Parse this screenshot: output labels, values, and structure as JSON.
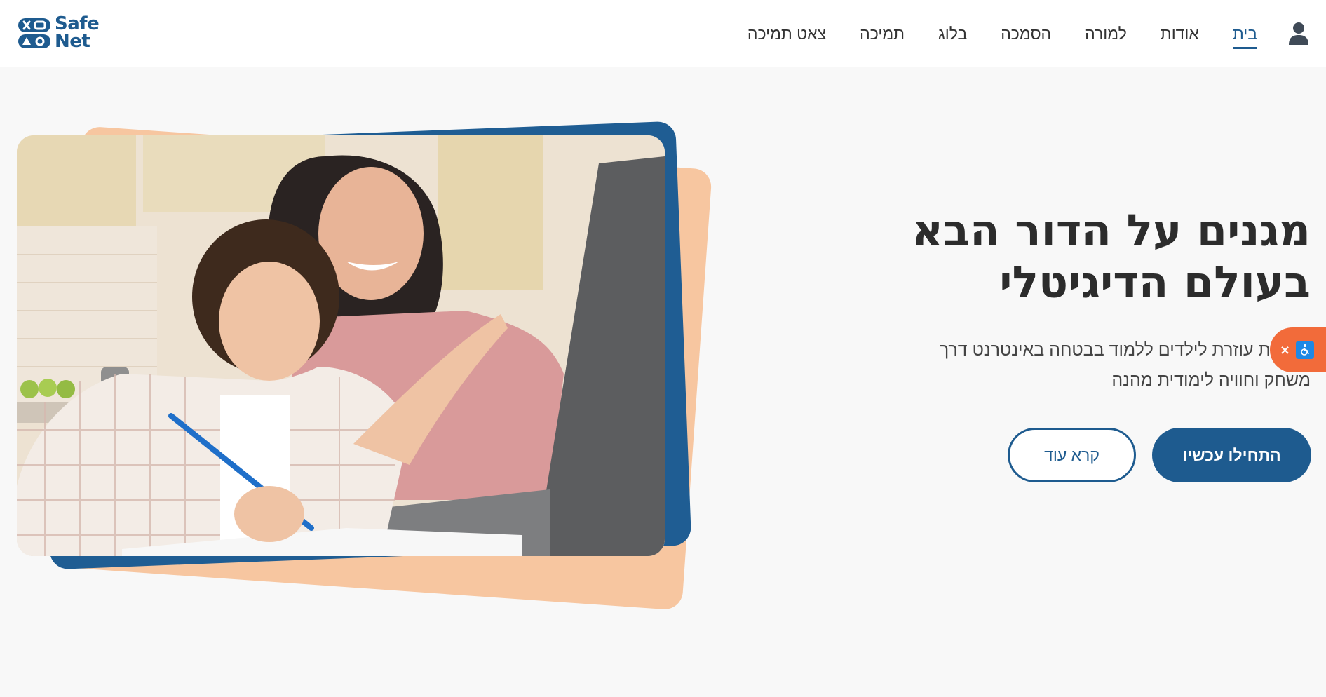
{
  "header": {
    "logo": {
      "line1": "Safe",
      "line2": "Net"
    },
    "nav": [
      {
        "label": "בית",
        "active": true
      },
      {
        "label": "אודות",
        "active": false
      },
      {
        "label": "למורה",
        "active": false
      },
      {
        "label": "הסמכה",
        "active": false
      },
      {
        "label": "בלוג",
        "active": false
      },
      {
        "label": "תמיכה",
        "active": false
      },
      {
        "label": "צאט תמיכה",
        "active": false
      }
    ],
    "user_icon": "user-icon"
  },
  "hero": {
    "title_line1": "מגנים על הדור הבא",
    "title_line2": "בעולם הדיגיטלי",
    "subtitle_line1": "מערכת עוזרת לילדים ללמוד בבטחה באינטרנט דרך",
    "subtitle_line2": "משחק וחוויה לימודית מהנה",
    "primary_button": "התחילו עכשיו",
    "secondary_button": "קרא עוד"
  },
  "accessibility_widget": {
    "close": "×",
    "icon": "wheelchair-icon"
  },
  "colors": {
    "brand": "#1e5b8f",
    "accent": "#f7c6a0",
    "widget": "#f26b3a"
  }
}
